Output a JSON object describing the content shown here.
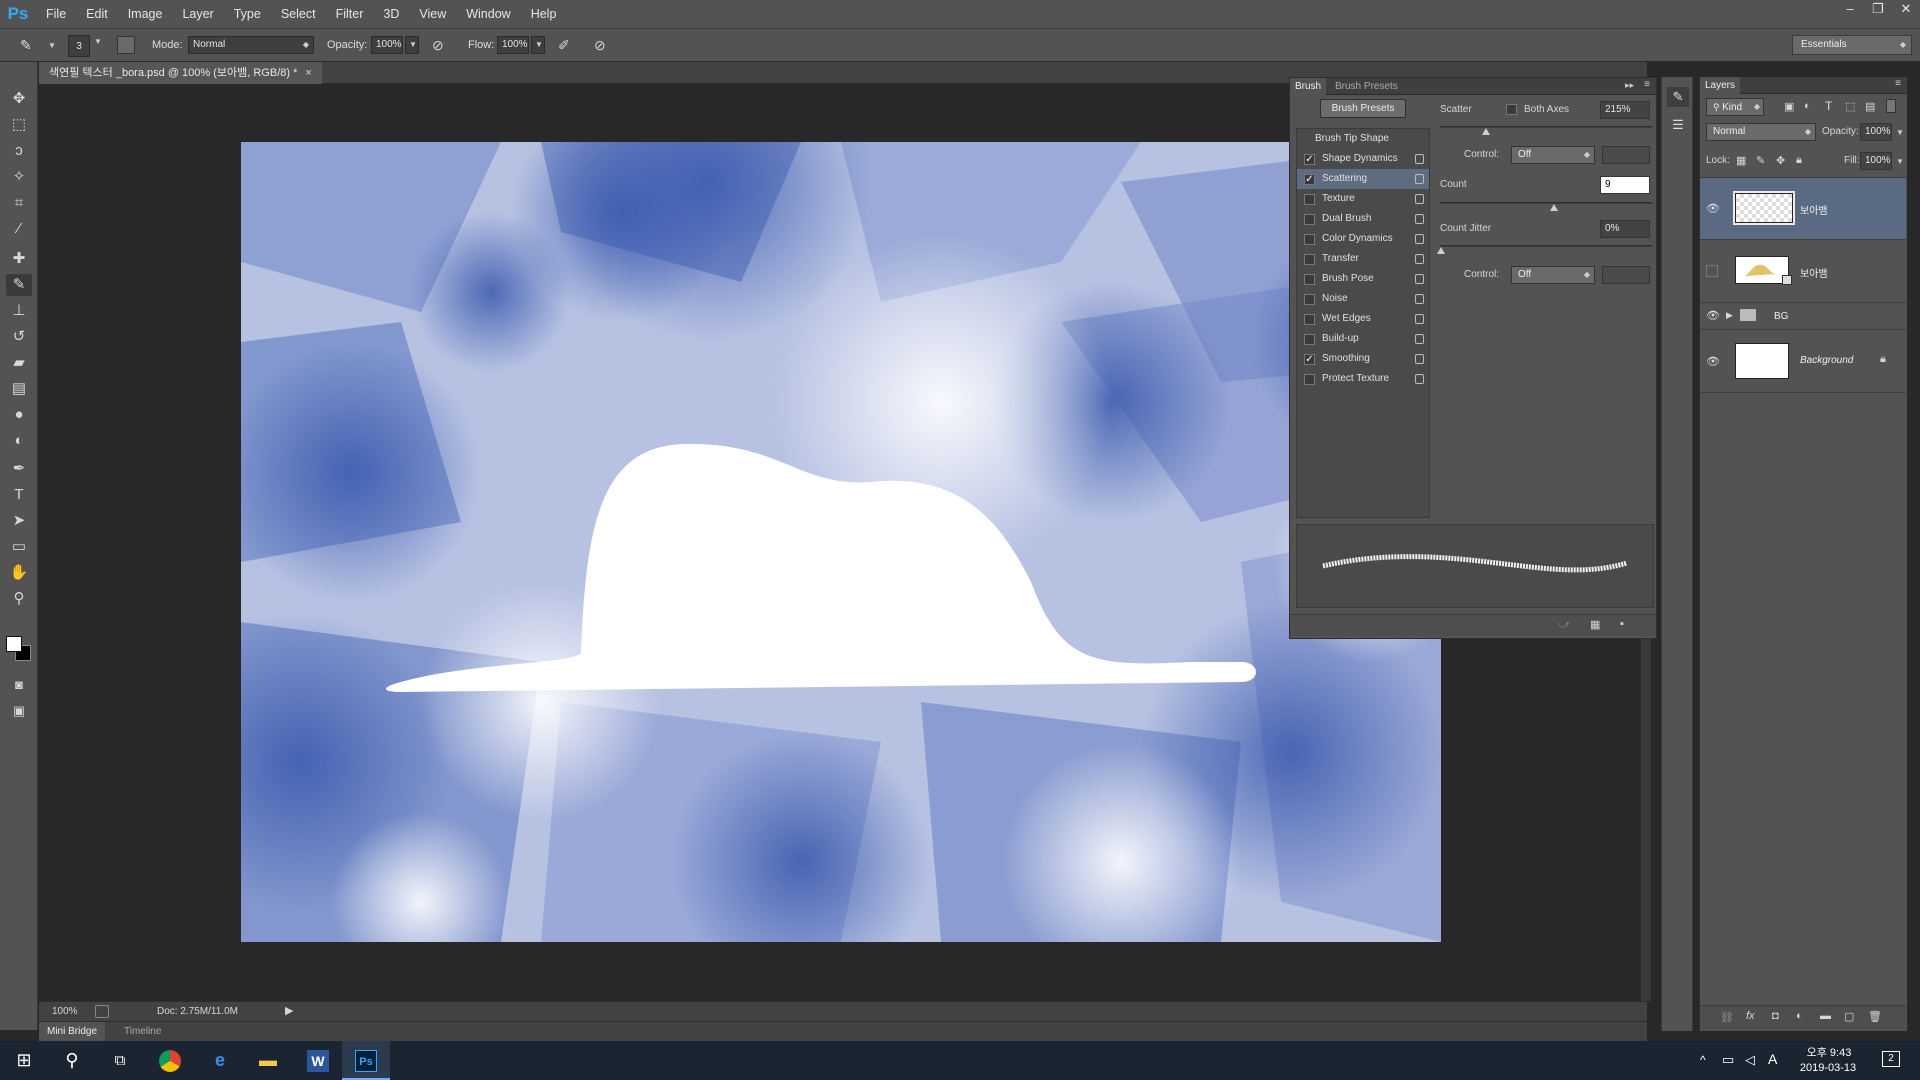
{
  "app": {
    "logo": "Ps"
  },
  "menu": [
    "File",
    "Edit",
    "Image",
    "Layer",
    "Type",
    "Select",
    "Filter",
    "3D",
    "View",
    "Window",
    "Help"
  ],
  "window_controls": [
    "–",
    "❐",
    "✕"
  ],
  "options_bar": {
    "brush_size": "3",
    "mode_label": "Mode:",
    "mode_value": "Normal",
    "opacity_label": "Opacity:",
    "opacity_value": "100%",
    "flow_label": "Flow:",
    "flow_value": "100%",
    "workspace": "Essentials"
  },
  "document": {
    "tab_title": "색연필 텍스터 _bora.psd @ 100% (보아뱀, RGB/8) *",
    "close_glyph": "×"
  },
  "status": {
    "zoom": "100%",
    "doc_info": "Doc: 2.75M/11.0M"
  },
  "bottom_tabs": [
    "Mini Bridge",
    "Timeline"
  ],
  "brush_panel": {
    "tabs": [
      "Brush",
      "Brush Presets"
    ],
    "presets_button": "Brush Presets",
    "tip_header": "Brush Tip Shape",
    "tips": [
      {
        "label": "Shape Dynamics",
        "checked": true
      },
      {
        "label": "Scattering",
        "checked": true
      },
      {
        "label": "Texture",
        "checked": false
      },
      {
        "label": "Dual Brush",
        "checked": false
      },
      {
        "label": "Color Dynamics",
        "checked": false
      },
      {
        "label": "Transfer",
        "checked": false
      },
      {
        "label": "Brush Pose",
        "checked": false
      },
      {
        "label": "Noise",
        "checked": false
      },
      {
        "label": "Wet Edges",
        "checked": false
      },
      {
        "label": "Build-up",
        "checked": false
      },
      {
        "label": "Smoothing",
        "checked": true
      },
      {
        "label": "Protect Texture",
        "checked": false
      }
    ],
    "scatter_label": "Scatter",
    "both_axes_label": "Both Axes",
    "scatter_value": "215%",
    "control_label": "Control:",
    "control_value": "Off",
    "count_label": "Count",
    "count_value": "9",
    "count_jitter_label": "Count Jitter",
    "count_jitter_value": "0%",
    "control2_label": "Control:",
    "control2_value": "Off"
  },
  "layers_panel": {
    "title": "Layers",
    "kind_filter": "Kind",
    "blend_mode": "Normal",
    "opacity_label": "Opacity:",
    "opacity_value": "100%",
    "lock_label": "Lock:",
    "fill_label": "Fill:",
    "fill_value": "100%",
    "layers": [
      {
        "name": "보아뱀",
        "visible": true,
        "selected": true
      },
      {
        "name": "보아뱀",
        "visible": false,
        "selected": false
      },
      {
        "name": "BG",
        "visible": true,
        "selected": false,
        "group": true
      },
      {
        "name": "Background",
        "visible": true,
        "selected": false,
        "locked": true
      }
    ]
  },
  "taskbar": {
    "time": "오후 9:43",
    "date": "2019-03-13",
    "ime": "A",
    "notify_count": "2"
  },
  "colors": {
    "canvas_blue": "#3f5fb0",
    "panel_bg": "#535353",
    "ps_blue": "#31a8ff"
  }
}
